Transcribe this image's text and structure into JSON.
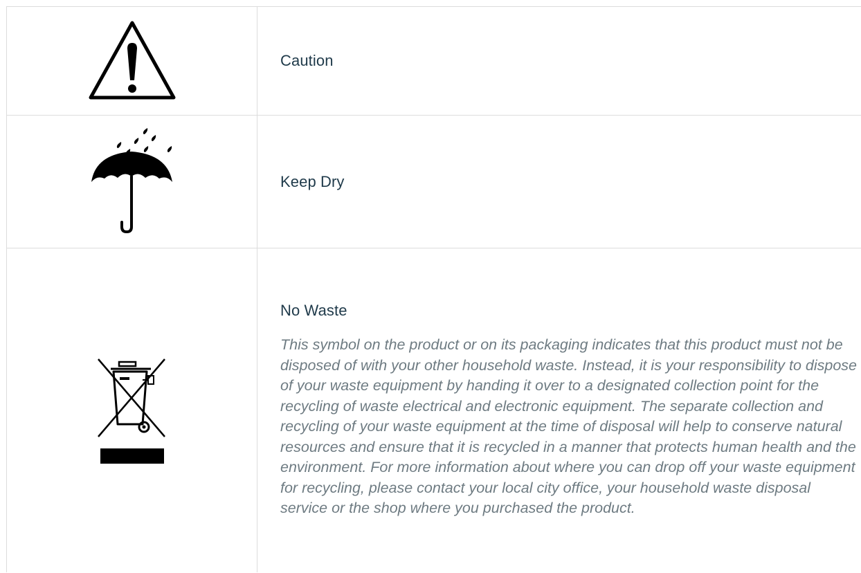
{
  "symbols": [
    {
      "icon": "caution-icon",
      "label": "Caution"
    },
    {
      "icon": "umbrella-icon",
      "label": "Keep Dry"
    },
    {
      "icon": "crossed-bin-icon",
      "label": "No Waste",
      "description": "This symbol on the product or on its packaging indicates that this product must not be disposed of with your other household waste. Instead, it is your responsibility to dispose of your waste equipment by handing it over to a designated collection point for the recycling of waste electrical and electronic equipment. The separate collection and recycling of your waste equipment at the time of disposal will help to conserve natural resources and ensure that it is recycled in a manner that protects human health and the environment. For more information about where you can drop off your waste equipment for recycling, please contact your local city office, your household waste disposal service or the shop where you purchased the product."
    }
  ],
  "colors": {
    "label": "#1f3a4a",
    "description": "#6e7b82",
    "border": "#dcdcdc",
    "icon": "#000000"
  }
}
